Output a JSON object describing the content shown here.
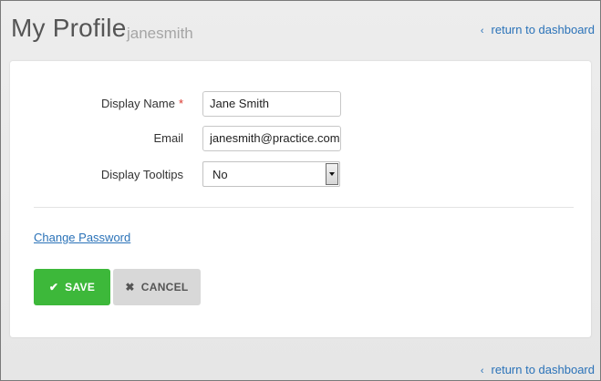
{
  "header": {
    "title": "My Profile",
    "username": "janesmith",
    "back_link": "return to dashboard",
    "back_icon": "chevron-left-icon"
  },
  "form": {
    "display_name": {
      "label": "Display Name",
      "required_marker": "*",
      "value": "Jane Smith"
    },
    "email": {
      "label": "Email",
      "value": "janesmith@practice.com"
    },
    "tooltips": {
      "label": "Display Tooltips",
      "value": "No"
    }
  },
  "links": {
    "change_password": "Change Password"
  },
  "buttons": {
    "save": "SAVE",
    "save_icon": "check-icon",
    "cancel": "CANCEL",
    "cancel_icon": "x-icon"
  },
  "footer": {
    "back_link": "return to dashboard"
  },
  "colors": {
    "accent_green": "#3db83a",
    "link_blue": "#2a72b8",
    "required_red": "#d9342b"
  }
}
